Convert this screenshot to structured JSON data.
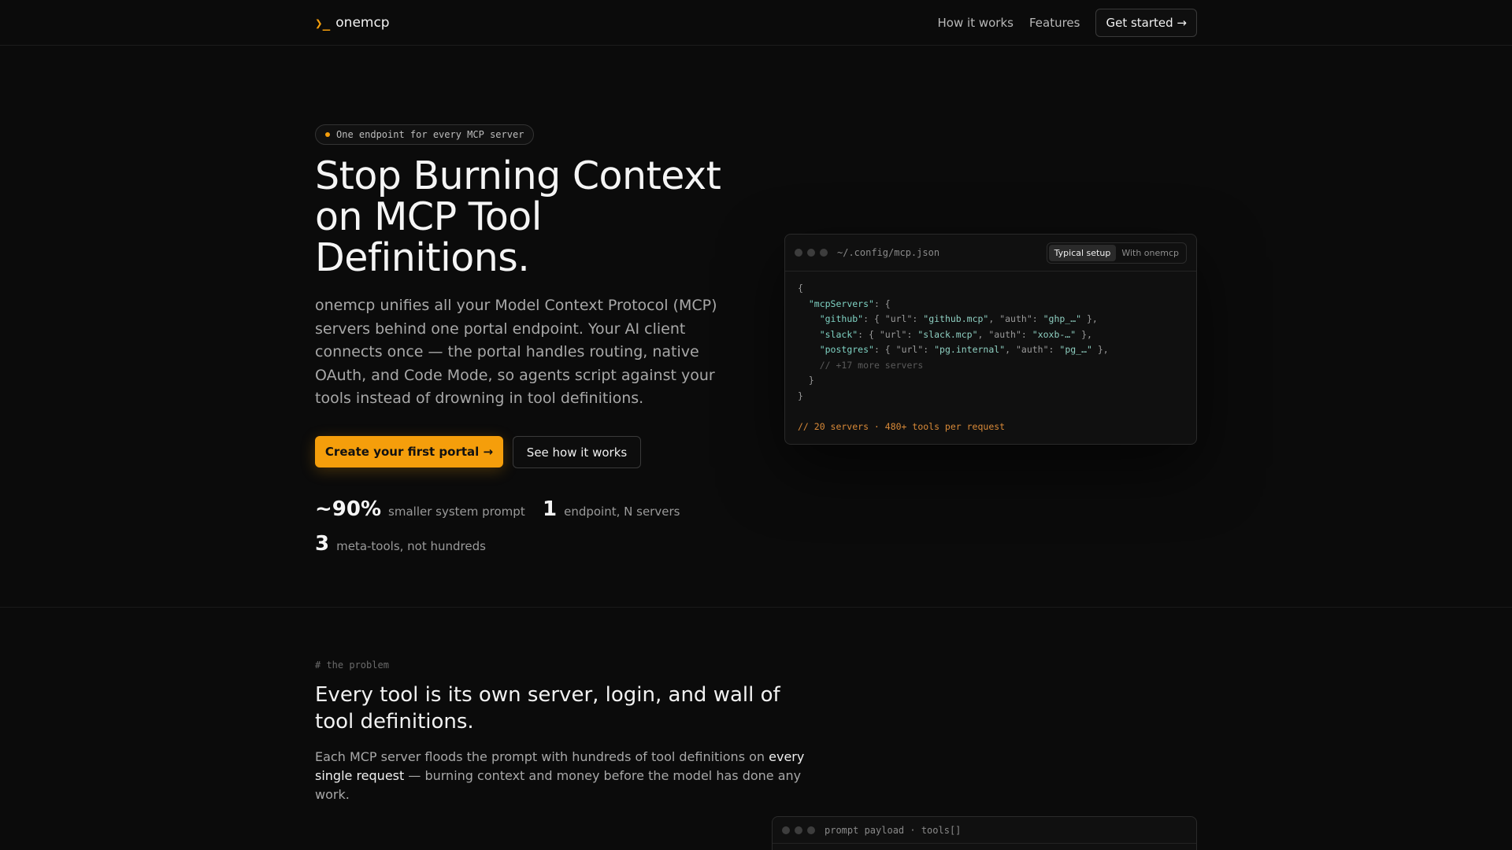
{
  "nav": {
    "brand_mark": "❯_",
    "brand_name": "onemcp",
    "links": [
      "How it works",
      "Features"
    ],
    "cta": "Get started →"
  },
  "hero": {
    "badge": "One endpoint for every MCP server",
    "title": "Stop Burning Context on MCP Tool Definitions.",
    "description": "onemcp unifies all your Model Context Protocol (MCP) servers behind one portal endpoint. Your AI client connects once — the portal handles routing, native OAuth, and Code Mode, so agents script against your tools instead of drowning in tool definitions.",
    "primary_cta": "Create your first portal →",
    "secondary_cta": "See how it works",
    "stats": [
      {
        "value": "~90%",
        "label": "smaller system prompt"
      },
      {
        "value": "1",
        "label": "endpoint, N servers"
      },
      {
        "value": "3",
        "label": "meta-tools, not hundreds"
      }
    ]
  },
  "code_window": {
    "path": "~/.config/mcp.json",
    "tabs": [
      "Typical setup",
      "With onemcp"
    ],
    "active_tab": "Typical setup",
    "lines": {
      "l1": "{",
      "l2_key": "\"mcpServers\"",
      "l2_rest": ": {",
      "github_key": "\"github\"",
      "github_url": "\"github.mcp\"",
      "github_auth": "\"ghp_…\"",
      "slack_key": "\"slack\"",
      "slack_url": "\"slack.mcp\"",
      "slack_auth": "\"xoxb-…\"",
      "postgres_key": "\"postgres\"",
      "postgres_url": "\"pg.internal\"",
      "postgres_auth": "\"pg_…\"",
      "more": "// +17 more servers",
      "close_inner": "}",
      "close_outer": "}",
      "footer": "// 20 servers · 480+ tools per request"
    }
  },
  "problem": {
    "tag": "# the problem",
    "title": "Every tool is its own server, login, and wall of tool definitions.",
    "desc_before": "Each MCP server floods the prompt with hundreds of tool definitions on ",
    "desc_em": "every single request",
    "desc_after": " — burning context and money before the model has done any work.",
    "payload_title": "prompt payload · tools[]"
  },
  "colors": {
    "accent": "#f59e0b",
    "background": "#0b0b0b"
  }
}
